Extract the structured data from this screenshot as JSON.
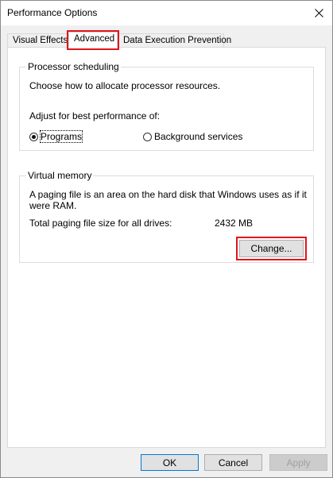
{
  "window": {
    "title": "Performance Options"
  },
  "tabs": [
    {
      "label": "Visual Effects"
    },
    {
      "label": "Advanced"
    },
    {
      "label": "Data Execution Prevention"
    }
  ],
  "processor": {
    "group_label": "Processor scheduling",
    "description": "Choose how to allocate processor resources.",
    "adjust_label": "Adjust for best performance of:",
    "options": [
      {
        "label": "Programs",
        "checked": true
      },
      {
        "label": "Background services",
        "checked": false
      }
    ]
  },
  "virtual_memory": {
    "group_label": "Virtual memory",
    "description": "A paging file is an area on the hard disk that Windows uses as if it were RAM.",
    "total_label": "Total paging file size for all drives:",
    "total_value": "2432 MB",
    "change_button": "Change..."
  },
  "footer": {
    "ok": "OK",
    "cancel": "Cancel",
    "apply": "Apply"
  },
  "colors": {
    "highlight": "#e0141e",
    "default_button_border": "#0078d7"
  }
}
